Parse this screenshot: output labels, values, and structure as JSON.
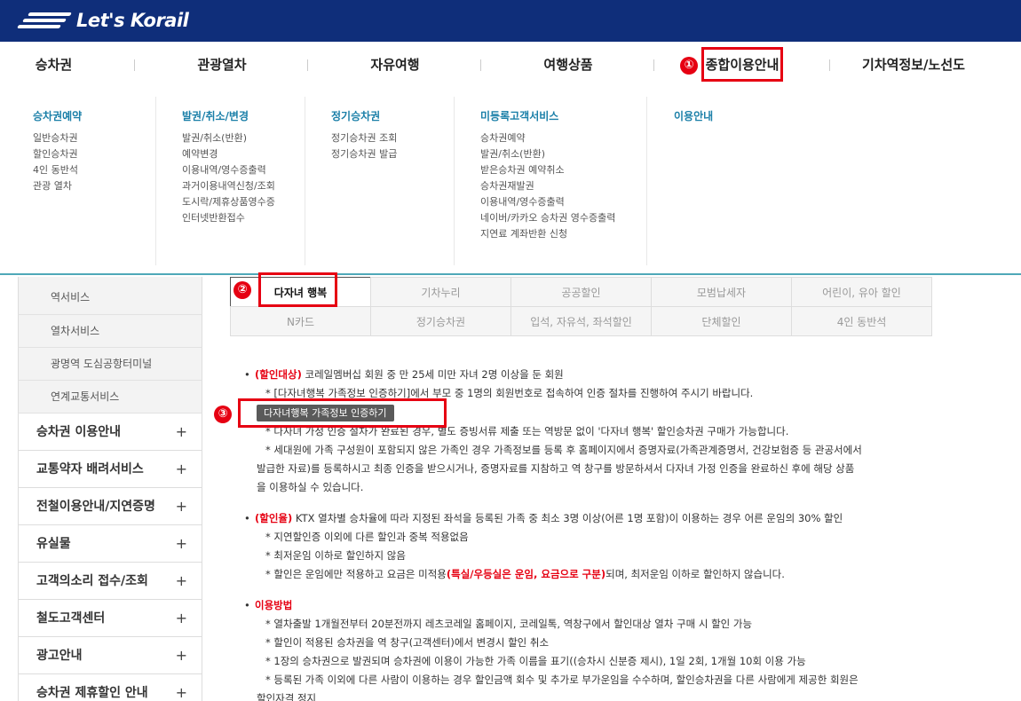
{
  "brand": {
    "logo_text": "Let's Korail",
    "topbar_color": "#0f2e7a"
  },
  "main_nav": [
    {
      "label": "승차권"
    },
    {
      "label": "관광열차"
    },
    {
      "label": "자유여행"
    },
    {
      "label": "여행상품"
    },
    {
      "label": "종합이용안내"
    },
    {
      "label": "기차역정보/노선도"
    }
  ],
  "mega_menu": [
    {
      "heading": "승차권예약",
      "items": [
        "일반승차권",
        "할인승차권",
        "4인 동반석",
        "관광 열차"
      ]
    },
    {
      "heading": "발권/취소/변경",
      "items": [
        "발권/취소(반환)",
        "예약변경",
        "이용내역/영수증출력",
        "과거이용내역신청/조회",
        "도시락/제휴상품영수증",
        "인터넷반환접수"
      ]
    },
    {
      "heading": "정기승차권",
      "items": [
        "정기승차권 조회",
        "정기승차권 발급"
      ]
    },
    {
      "heading": "미등록고객서비스",
      "items": [
        "승차권예약",
        "발권/취소(반환)",
        "받은승차권 예약취소",
        "승차권재발권",
        "이용내역/영수증출력",
        "네이버/카카오 승차권 영수증출력",
        "지연료 계좌반환 신청"
      ]
    },
    {
      "heading": "이용안내",
      "items": []
    }
  ],
  "sidebar": {
    "sub_items": [
      "역서비스",
      "열차서비스",
      "광명역 도심공항터미널",
      "연계교통서비스"
    ],
    "items": [
      "승차권 이용안내",
      "교통약자 배려서비스",
      "전철이용안내/지연증명",
      "유실물",
      "고객의소리 접수/조회",
      "철도고객센터",
      "광고안내",
      "승차권 제휴할인 안내"
    ]
  },
  "tabs": {
    "row1": [
      "다자녀 행복",
      "기차누리",
      "공공할인",
      "모범납세자",
      "어린이, 유아 할인"
    ],
    "row2": [
      "N카드",
      "정기승차권",
      "입석, 자유석, 좌석할인",
      "단체할인",
      "4인 동반석"
    ],
    "active": "다자녀 행복"
  },
  "annotations": {
    "m1": "①",
    "m2": "②",
    "m3": "③"
  },
  "content": {
    "s1": {
      "label": "(할인대상)",
      "text": " 코레일멤버십 회원 중 만 25세 미만 자녀 2명 이상을 둔 회원",
      "n1": "* [다자녀행복 가족정보 인증하기]에서 부모 중 1명의 회원번호로 접속하여 인증 절차를 진행하여 주시기 바랍니다.",
      "button": "다자녀행복 가족정보 인증하기",
      "n2": "* 다자녀 가정 인증 절차가 완료된 경우, 별도 증빙서류 제출 또는 역방문 없이 '다자녀 행복' 할인승차권 구매가 가능합니다.",
      "n3a": "* 세대원에 가족 구성원이 포함되지 않은 가족인 경우 가족정보를 등록 후 홈페이지에서 증명자료(가족관계증명서, 건강보험증 등 관공서에서",
      "n3b": "발급한 자료)를 등록하시고 최종 인증을 받으시거나, 증명자료를 지참하고 역 창구를 방문하셔서 다자녀 가정 인증을 완료하신 후에 해당 상품",
      "n3c": "을 이용하실 수 있습니다."
    },
    "s2": {
      "label": "(할인율)",
      "text": " KTX 열차별 승차율에 따라 지정된 좌석을 등록된 가족 중 최소 3명 이상(어른 1명 포함)이 이용하는 경우 어른 운임의 30% 할인",
      "n1": "* 지연할인증 이외에 다른 할인과 중복 적용없음",
      "n2": "* 최저운임 이하로 할인하지 않음",
      "n3_pre": "* 할인은 운임에만 적용하고 요금은 미적용",
      "n3_red": "(특실/우등실은 운임, 요금으로 구분)",
      "n3_post": "되며, 최저운임 이하로 할인하지 않습니다."
    },
    "s3": {
      "label": "이용방법",
      "n1": "* 열차출발 1개월전부터 20분전까지 레츠코레일 홈페이지, 코레일톡, 역창구에서 할인대상 열차 구매 시 할인 가능",
      "n2": "* 할인이 적용된 승차권을 역 창구(고객센터)에서 변경시 할인 취소",
      "n3": "* 1장의 승차권으로 발권되며 승차권에 이용이 가능한 가족 이름을 표기((승차시 신분증 제시), 1일 2회, 1개월 10회 이용 가능",
      "n4a": "* 등록된 가족 이외에 다른 사람이 이용하는 경우 할인금액 회수 및 추가로 부가운임을 수수하며, 할인승차권을 다른 사람에게 제공한 회원은",
      "n4b": "할인자격 정지"
    }
  }
}
